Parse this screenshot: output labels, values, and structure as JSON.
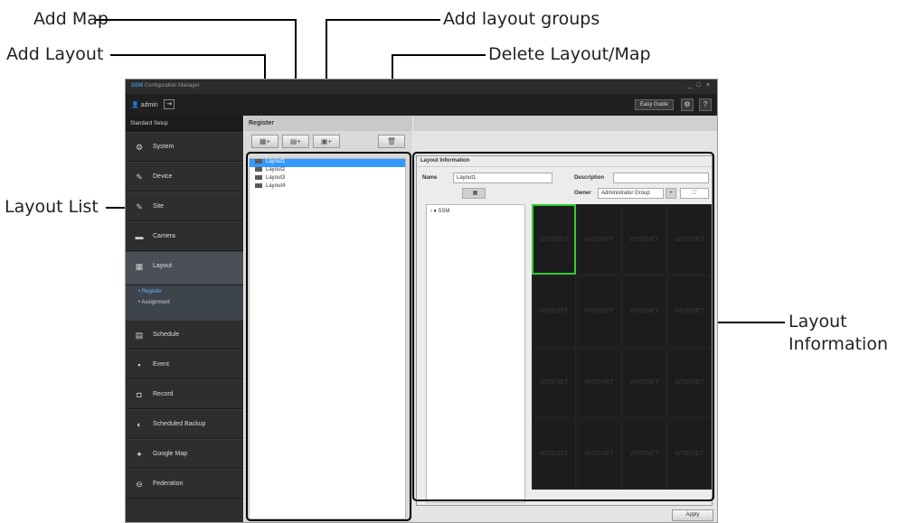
{
  "callouts": {
    "add_map": "Add Map",
    "add_layout_groups": "Add layout groups",
    "add_layout": "Add Layout",
    "delete_layout_map": "Delete Layout/Map",
    "layout_list": "Layout List",
    "layout_information_1": "Layout",
    "layout_information_2": "Information"
  },
  "app": {
    "brand": "SSM",
    "title": "Configuration Manager",
    "window_controls": "_ □ ×",
    "user": "admin",
    "easy_guide": "Easy Guide",
    "gear_icon": "⚙",
    "help": "?"
  },
  "sidebar": {
    "header": "Standard Setup",
    "items": [
      {
        "label": "System",
        "icon": "⚙"
      },
      {
        "label": "Device",
        "icon": "✎"
      },
      {
        "label": "Site",
        "icon": "✎"
      },
      {
        "label": "Camera",
        "icon": "▬"
      },
      {
        "label": "Layout",
        "icon": "▦"
      },
      {
        "label": "Schedule",
        "icon": "▤"
      },
      {
        "label": "Event",
        "icon": "▪"
      },
      {
        "label": "Record",
        "icon": "◘"
      },
      {
        "label": "Scheduled Backup",
        "icon": "◐"
      },
      {
        "label": "Google Map",
        "icon": "✦"
      },
      {
        "label": "Federation",
        "icon": "⊖"
      }
    ],
    "layout_sub": [
      "Register",
      "Assignment"
    ]
  },
  "register": {
    "header": "Register",
    "layouts": [
      "Layout1",
      "Layout2",
      "Layout3",
      "Layout4"
    ]
  },
  "layout_info": {
    "title": "Layout Information",
    "name_label": "Name",
    "name_value": "Layout1",
    "description_label": "Description",
    "description_value": "",
    "owner_label": "Owner",
    "owner_value": "Administrator Group",
    "tree_root": "SSM",
    "cell_text": "WISENET",
    "apply": "Apply"
  }
}
